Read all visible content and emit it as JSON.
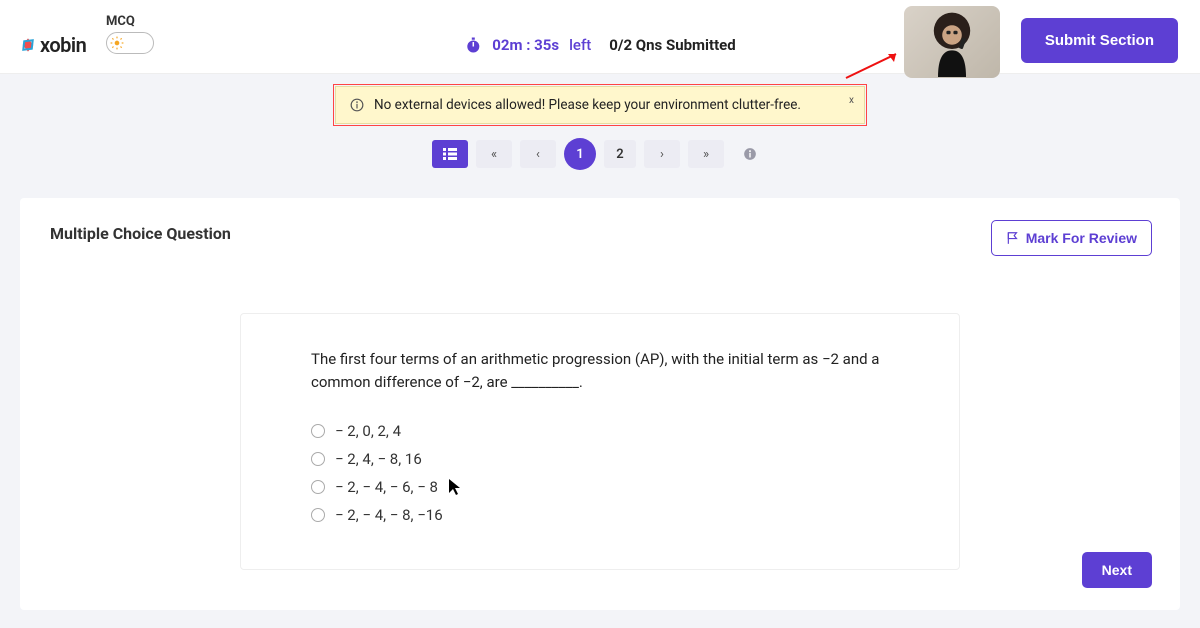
{
  "brand": {
    "name": "xobin"
  },
  "section_label": "MCQ",
  "timer": {
    "time": "02m : 35s",
    "suffix": "left"
  },
  "progress": "0/2 Qns Submitted",
  "submit_label": "Submit Section",
  "alert": {
    "text": "No external devices allowed! Please keep your environment clutter-free.",
    "close": "x"
  },
  "pager": {
    "first": "«",
    "prev": "‹",
    "pages": [
      "1",
      "2"
    ],
    "active_index": 0,
    "next": "›",
    "last": "»"
  },
  "card": {
    "title": "Multiple Choice Question",
    "mark_label": "Mark For Review",
    "next_label": "Next"
  },
  "question": {
    "text": "The first four terms of an arithmetic progression (AP), with the initial term as −2 and a common difference of −2, are __________.",
    "options": [
      "− 2, 0, 2, 4",
      "− 2, 4, − 8, 16",
      "− 2, − 4, − 6, − 8",
      "− 2, − 4, − 8, −16"
    ]
  }
}
